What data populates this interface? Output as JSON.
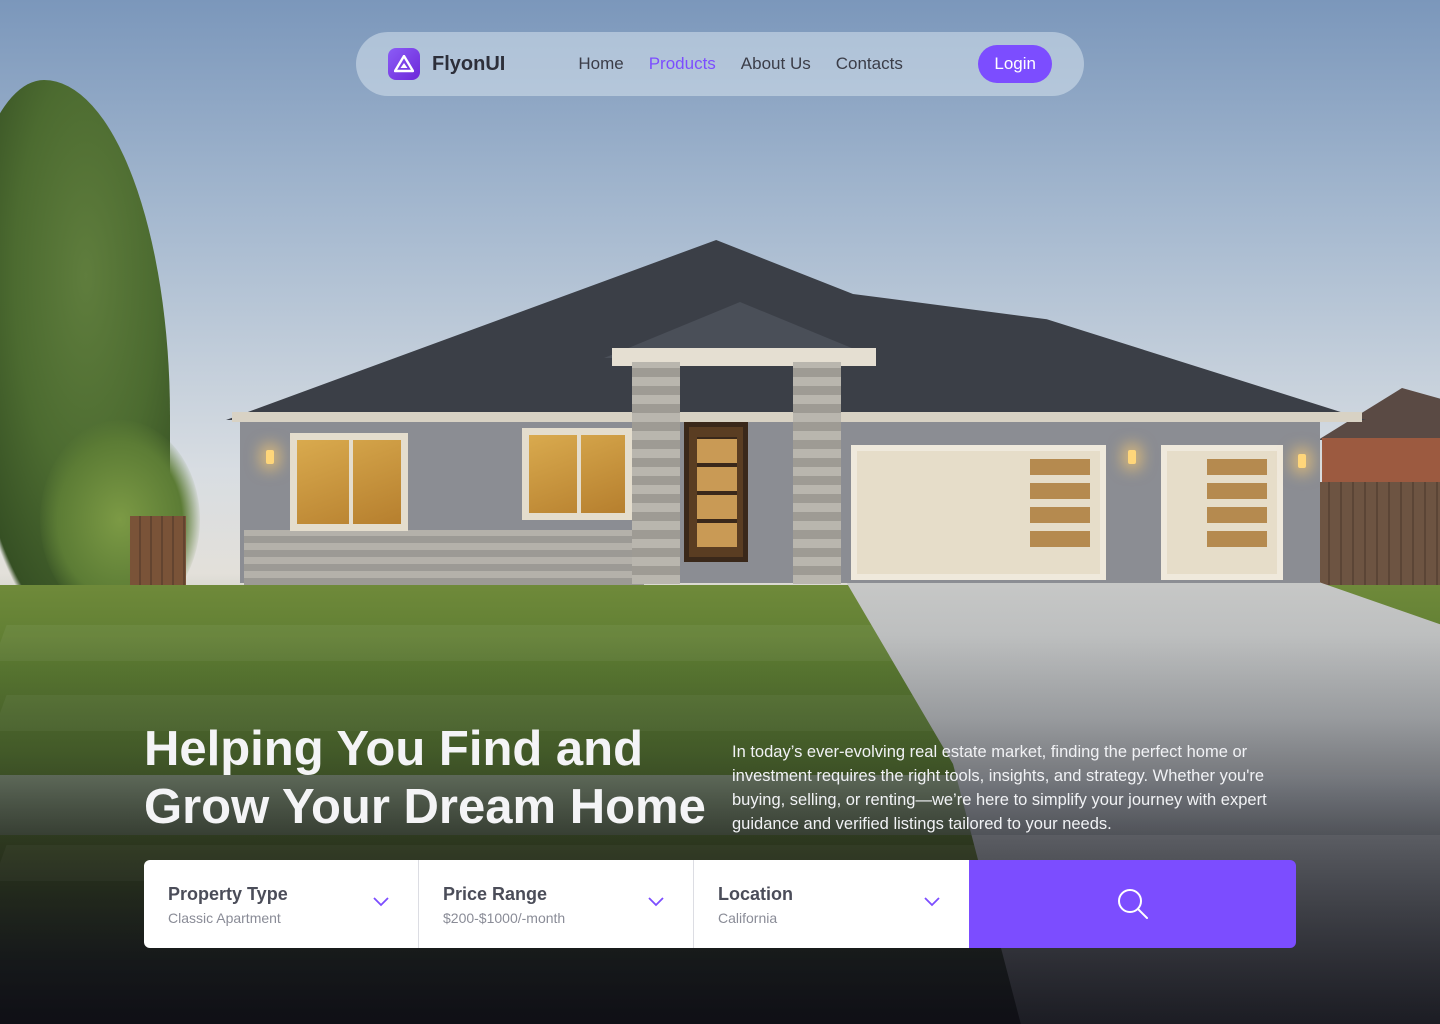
{
  "colors": {
    "accent": "#7c4dff",
    "navbar_bg": "#d6e1ec",
    "text_dark": "#2d2f3a"
  },
  "navbar": {
    "brand": {
      "name": "FlyonUI",
      "icon": "flyonui-logo-icon"
    },
    "links": [
      {
        "label": "Home",
        "active": false
      },
      {
        "label": "Products",
        "active": true
      },
      {
        "label": "About Us",
        "active": false
      },
      {
        "label": "Contacts",
        "active": false
      }
    ],
    "login_label": "Login"
  },
  "hero": {
    "headline_line1": "Helping You Find and",
    "headline_line2": "Grow Your Dream Home",
    "lead": "In today’s ever-evolving real estate market, finding the perfect home or investment requires the right tools, insights, and strategy. Whether you're buying, selling, or renting—we’re here to simplify your journey with expert guidance and verified listings tailored to your needs."
  },
  "search": {
    "filters": [
      {
        "label": "Property Type",
        "value": "Classic Apartment",
        "icon": "chevron-down-icon"
      },
      {
        "label": "Price Range",
        "value": "$200-$1000/-month",
        "icon": "chevron-down-icon"
      },
      {
        "label": "Location",
        "value": "California",
        "icon": "chevron-down-icon"
      }
    ],
    "button_icon": "search-icon"
  }
}
